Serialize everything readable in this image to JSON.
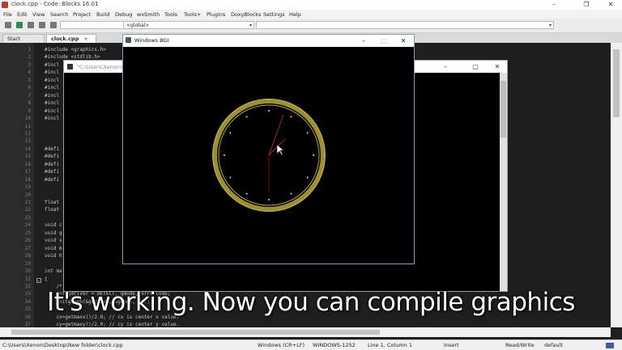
{
  "window": {
    "title": "clock.cpp - Code::Blocks 16.01"
  },
  "menu": [
    "File",
    "Edit",
    "View",
    "Search",
    "Project",
    "Build",
    "Debug",
    "wxSmith",
    "Tools",
    "Tools+",
    "Plugins",
    "DoxyBlocks",
    "Settings",
    "Help"
  ],
  "toolbar": {
    "scope_combo": "<global>",
    "symbol_combo": ""
  },
  "tabs": [
    {
      "label": "Start here",
      "active": false
    },
    {
      "label": "clock.cpp",
      "active": true
    }
  ],
  "editor": {
    "lines": [
      {
        "n": "1",
        "code": "#include <graphics.h>"
      },
      {
        "n": "2",
        "code": "#include <stdlib.h>"
      },
      {
        "n": "3",
        "code": "#incl"
      },
      {
        "n": "4",
        "code": "#incl"
      },
      {
        "n": "5",
        "code": "#incl"
      },
      {
        "n": "6",
        "code": "#incl"
      },
      {
        "n": "7",
        "code": "#incl"
      },
      {
        "n": "8",
        "code": "#incl"
      },
      {
        "n": "9",
        "code": "#incl"
      },
      {
        "n": "10",
        "code": "#incl"
      },
      {
        "n": "11",
        "code": ""
      },
      {
        "n": "12",
        "code": ""
      },
      {
        "n": "13",
        "code": ""
      },
      {
        "n": "14",
        "code": "#defi"
      },
      {
        "n": "15",
        "code": "#defi"
      },
      {
        "n": "16",
        "code": "#defi"
      },
      {
        "n": "17",
        "code": "#defi"
      },
      {
        "n": "18",
        "code": "#defi"
      },
      {
        "n": "19",
        "code": ""
      },
      {
        "n": "20",
        "code": ""
      },
      {
        "n": "21",
        "code": "float"
      },
      {
        "n": "22",
        "code": "float"
      },
      {
        "n": "23",
        "code": ""
      },
      {
        "n": "24",
        "code": "void c"
      },
      {
        "n": "25",
        "code": "void g"
      },
      {
        "n": "26",
        "code": "void s"
      },
      {
        "n": "27",
        "code": "void m"
      },
      {
        "n": "28",
        "code": "void h"
      },
      {
        "n": "29",
        "code": ""
      },
      {
        "n": "30",
        "code": "int ma"
      },
      {
        "n": "31",
        "code": "{"
      },
      {
        "n": "32",
        "code": "    /* req"
      },
      {
        "n": "33",
        "code": "    int gdriver = DETECT, gmode, errorcode;"
      },
      {
        "n": "34",
        "code": "    initgraph(&gdriver, &gmode, \"\");"
      },
      {
        "n": "35",
        "code": ""
      },
      {
        "n": "36",
        "code": "    cx=getmaxx()/2.0; // cx is center x value."
      },
      {
        "n": "37",
        "code": "    cy=getmaxy()/2.0; // cy is center y value."
      }
    ]
  },
  "console": {
    "title": "\"C:\\Users\\Xenon\\D"
  },
  "bgi": {
    "title": "Windows BGI"
  },
  "caption": "It's working. Now you can compile graphics",
  "status": {
    "path": "C:\\Users\\Xenon\\Desktop\\New folder\\clock.cpp",
    "eol": "Windows (CR+LF)",
    "encoding": "WINDOWS-1252",
    "position": "Line 1, Column 1",
    "mode": "Insert",
    "access": "Read/Write",
    "lang": "default"
  },
  "colors": {
    "clock_ring": "#b5a642",
    "second_hand": "#8b0000",
    "minute_hand": "#a52a2a"
  }
}
